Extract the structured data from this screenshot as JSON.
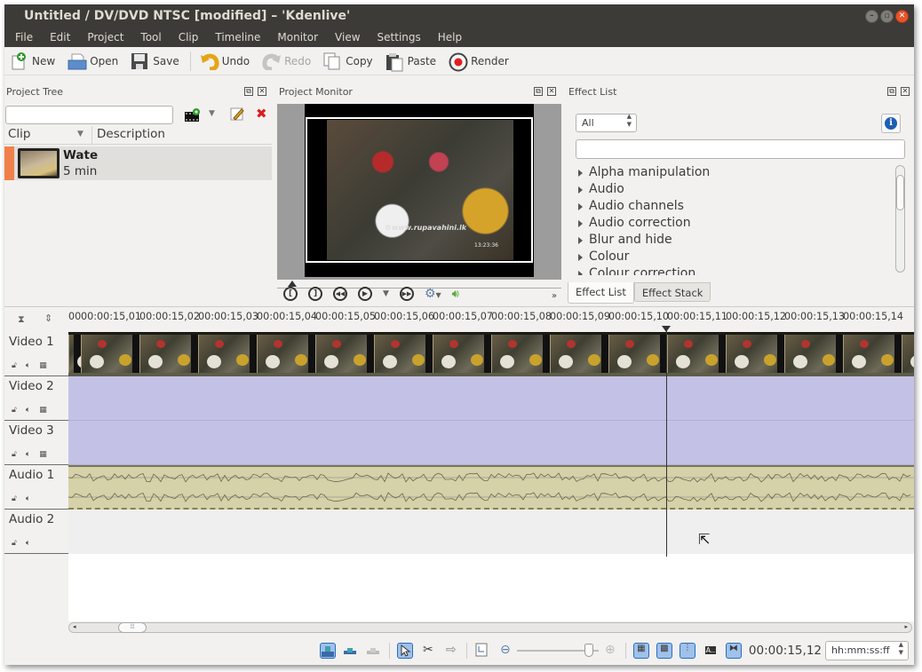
{
  "window": {
    "title": "Untitled / DV/DVD NTSC [modified] – 'Kdenlive'",
    "controls": [
      "minimize",
      "maximize",
      "close"
    ]
  },
  "menu": [
    "File",
    "Edit",
    "Project",
    "Tool",
    "Clip",
    "Timeline",
    "Monitor",
    "View",
    "Settings",
    "Help"
  ],
  "toolbar": {
    "new": "New",
    "open": "Open",
    "save": "Save",
    "undo": "Undo",
    "redo": "Redo",
    "copy": "Copy",
    "paste": "Paste",
    "render": "Render"
  },
  "project_tree": {
    "title": "Project Tree",
    "search_value": "",
    "columns": [
      "Clip",
      "Description"
    ],
    "clips": [
      {
        "name": "Wate",
        "duration": "5 min"
      }
    ]
  },
  "project_monitor": {
    "title": "Project Monitor",
    "watermark": "©www.rupavahini.lk",
    "timestamp": "13:23:36"
  },
  "effect_list": {
    "title": "Effect List",
    "filter": "All",
    "search_value": "",
    "categories": [
      "Alpha manipulation",
      "Audio",
      "Audio channels",
      "Audio correction",
      "Blur and hide",
      "Colour",
      "Colour correction"
    ],
    "tabs": [
      "Effect List",
      "Effect Stack"
    ],
    "active_tab": "Effect List"
  },
  "timeline": {
    "ruler_prefix": "00",
    "ruler_ticks": [
      "00:00:15,01",
      "00:00:15,02",
      "00:00:15,03",
      "00:00:15,04",
      "00:00:15,05",
      "00:00:15,06",
      "00:00:15,07",
      "00:00:15,08",
      "00:00:15,09",
      "00:00:15,10",
      "00:00:15,11",
      "00:00:15,12",
      "00:00:15,13",
      "00:00:15,14"
    ],
    "tracks": [
      {
        "name": "Video 1",
        "type": "video"
      },
      {
        "name": "Video 2",
        "type": "video"
      },
      {
        "name": "Video 3",
        "type": "video"
      },
      {
        "name": "Audio 1",
        "type": "audio"
      },
      {
        "name": "Audio 2",
        "type": "audio"
      }
    ],
    "playhead_position": "00:00:15,10"
  },
  "statusbar": {
    "timecode": "00:00:15,12",
    "time_format": "hh:mm:ss:ff",
    "zoom_level_fraction": 0.93
  },
  "colors": {
    "titlebar": "#3c3b37",
    "video_track": "#c3c2e6",
    "audio_clip": "#d5d1a8",
    "clip_marker": "#f0804a"
  }
}
